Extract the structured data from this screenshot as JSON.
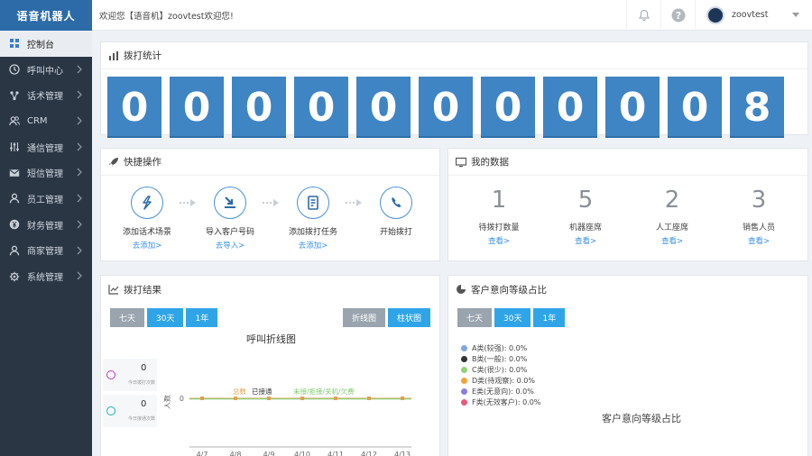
{
  "app": {
    "title": "语音机器人"
  },
  "header": {
    "welcome": "欢迎您【语音机】zoovtest欢迎您!",
    "username": "zoovtest"
  },
  "sidebar": {
    "items": [
      {
        "label": "控制台",
        "icon": "dashboard-icon",
        "active": true
      },
      {
        "label": "呼叫中心",
        "icon": "clock-icon"
      },
      {
        "label": "话术管理",
        "icon": "flow-icon"
      },
      {
        "label": "CRM",
        "icon": "users-icon"
      },
      {
        "label": "通信管理",
        "icon": "sliders-icon"
      },
      {
        "label": "短信管理",
        "icon": "mail-icon"
      },
      {
        "label": "员工管理",
        "icon": "user-icon"
      },
      {
        "label": "财务管理",
        "icon": "yen-icon"
      },
      {
        "label": "商家管理",
        "icon": "user-icon"
      },
      {
        "label": "系统管理",
        "icon": "gear-icon"
      }
    ]
  },
  "dial_stats": {
    "title": "拨打统计",
    "digits": [
      "0",
      "0",
      "0",
      "0",
      "0",
      "0",
      "0",
      "0",
      "0",
      "0",
      "8"
    ]
  },
  "quick_ops": {
    "title": "快捷操作",
    "items": [
      {
        "label": "添加话术场景",
        "link": "去添加>",
        "icon": "flash-icon"
      },
      {
        "label": "导入客户号码",
        "link": "去导入>",
        "icon": "import-icon"
      },
      {
        "label": "添加拨打任务",
        "link": "去添加>",
        "icon": "task-icon"
      },
      {
        "label": "开始拨打",
        "link": "",
        "icon": "phone-icon"
      }
    ]
  },
  "my_data": {
    "title": "我的数据",
    "items": [
      {
        "value": "1",
        "label": "待拨打数量",
        "link": "查看>"
      },
      {
        "value": "5",
        "label": "机器座席",
        "link": "查看>"
      },
      {
        "value": "2",
        "label": "人工座席",
        "link": "查看>"
      },
      {
        "value": "3",
        "label": "销售人员",
        "link": "查看>"
      }
    ]
  },
  "dial_results": {
    "title": "拨打结果",
    "range_buttons": [
      "七天",
      "30天",
      "1年"
    ],
    "view_buttons": [
      "折线图",
      "柱状图"
    ],
    "chart_title": "呼叫折线图",
    "summary": [
      {
        "value": "0",
        "label": "今日拨打次数"
      },
      {
        "value": "0",
        "label": "今日接通次数"
      }
    ],
    "colors": {
      "summary_1": "#c03cc0",
      "summary_2": "#18b7b0"
    }
  },
  "intent": {
    "title": "客户意向等级占比",
    "range_buttons": [
      "七天",
      "30天",
      "1年"
    ],
    "chart_title": "客户意向等级占比",
    "legend": [
      {
        "label": "A类(较强): 0.0%",
        "color": "#7ea6e0"
      },
      {
        "label": "B类(一般): 0.0%",
        "color": "#333333"
      },
      {
        "label": "C类(很少): 0.0%",
        "color": "#8fd27a"
      },
      {
        "label": "D类(待观察): 0.0%",
        "color": "#f0a33a"
      },
      {
        "label": "E类(无意向): 0.0%",
        "color": "#8a7ee0"
      },
      {
        "label": "F类(无效客户): 0.0%",
        "color": "#e85a7a"
      }
    ]
  },
  "chart_data": {
    "type": "line",
    "title": "呼叫折线图",
    "x": [
      "4/7",
      "4/8",
      "4/9",
      "4/10",
      "4/11",
      "4/12",
      "4/13"
    ],
    "series": [
      {
        "name": "总数",
        "values": [
          0,
          0,
          0,
          0,
          0,
          0,
          0
        ],
        "color": "#e0a050"
      },
      {
        "name": "已接通",
        "values": [
          0,
          0,
          0,
          0,
          0,
          0,
          0
        ],
        "color": "#333333"
      },
      {
        "name": "未接/拒接/关机/欠费",
        "values": [
          0,
          0,
          0,
          0,
          0,
          0,
          0
        ],
        "color": "#7cc96b"
      }
    ],
    "ylabel": "人数",
    "y_ticks": [
      "0"
    ]
  }
}
